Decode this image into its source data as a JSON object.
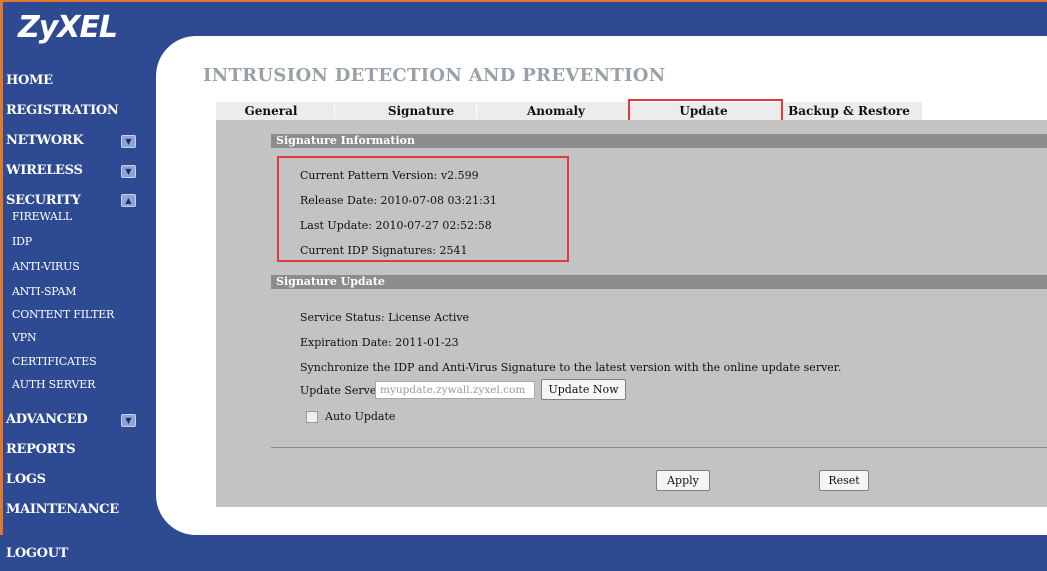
{
  "brand": {
    "logo": "ZyXEL"
  },
  "sidebar": {
    "items": [
      {
        "label": "HOME"
      },
      {
        "label": "REGISTRATION"
      },
      {
        "label": "NETWORK",
        "chevron": "▼"
      },
      {
        "label": "WIRELESS",
        "chevron": "▼"
      },
      {
        "label": "SECURITY",
        "chevron": "▲"
      },
      {
        "label": "ADVANCED",
        "chevron": "▼"
      },
      {
        "label": "REPORTS"
      },
      {
        "label": "LOGS"
      },
      {
        "label": "MAINTENANCE"
      },
      {
        "label": "LOGOUT"
      }
    ],
    "security_sub": [
      "FIREWALL",
      "IDP",
      "ANTI-VIRUS",
      "ANTI-SPAM",
      "CONTENT FILTER",
      "VPN",
      "CERTIFICATES",
      "AUTH SERVER"
    ]
  },
  "page": {
    "title": "INTRUSION DETECTION AND PREVENTION"
  },
  "tabs": [
    {
      "label": "General"
    },
    {
      "label": "Signature"
    },
    {
      "label": "Anomaly"
    },
    {
      "label": "Update",
      "active": true
    },
    {
      "label": "Backup & Restore"
    }
  ],
  "signature_info": {
    "header": "Signature Information",
    "pattern_version": "Current Pattern Version: v2.599",
    "release_date": "Release Date: 2010-07-08 03:21:31",
    "last_update": "Last Update: 2010-07-27 02:52:58",
    "idp_signatures": "Current IDP Signatures: 2541"
  },
  "signature_update": {
    "header": "Signature Update",
    "service_status": "Service Status: License Active",
    "expiration": "Expiration Date: 2011-01-23",
    "sync_text": "Synchronize the IDP and Anti-Virus Signature to the latest version with the online update server.",
    "server_label": "Update Server:",
    "server_value": "myupdate.zywall.zyxel.com",
    "update_now": "Update Now",
    "auto_update_label": "Auto Update",
    "auto_update_checked": false
  },
  "actions": {
    "apply": "Apply",
    "reset": "Reset"
  },
  "colors": {
    "frame": "#2d4a93",
    "highlight": "#e03a3a",
    "panel": "#c3c3c3",
    "section_bar": "#8c8c8c",
    "title": "#9aa0a8"
  }
}
